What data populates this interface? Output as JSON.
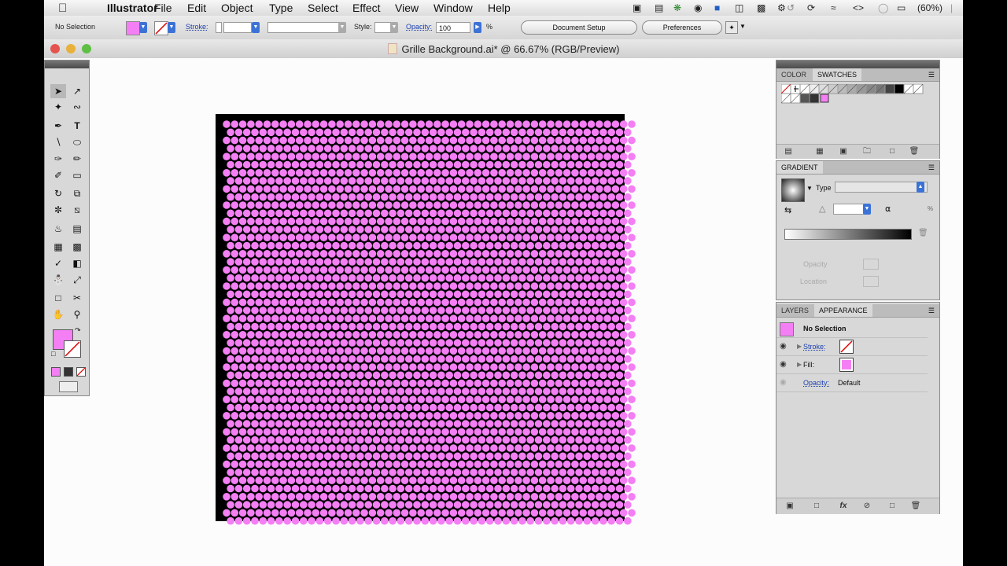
{
  "menubar": {
    "app_name": "Illustrator",
    "items": [
      "File",
      "Edit",
      "Object",
      "Type",
      "Select",
      "Effect",
      "View",
      "Window",
      "Help"
    ],
    "battery": "(60%)"
  },
  "control_bar": {
    "selection_status": "No Selection",
    "stroke_label": "Stroke:",
    "style_label": "Style:",
    "opacity_label": "Opacity:",
    "opacity_value": "100",
    "opacity_unit": "%",
    "document_setup_label": "Document Setup",
    "preferences_label": "Preferences"
  },
  "window": {
    "title": "Grille Background.ai* @ 66.67% (RGB/Preview)"
  },
  "colors": {
    "fill": "#f47ff4",
    "artboard": "#000000",
    "canvas": "#fcfcfc"
  },
  "swatches_panel": {
    "tabs": [
      "COLOR",
      "SWATCHES"
    ]
  },
  "gradient_panel": {
    "title": "GRADIENT",
    "type_label": "Type",
    "opacity_label": "Opacity",
    "location_label": "Location"
  },
  "appearance_panel": {
    "tabs": [
      "LAYERS",
      "APPEARANCE"
    ],
    "header": "No Selection",
    "stroke_label": "Stroke:",
    "fill_label": "Fill:",
    "opacity_label": "Opacity:",
    "opacity_value": "Default"
  }
}
